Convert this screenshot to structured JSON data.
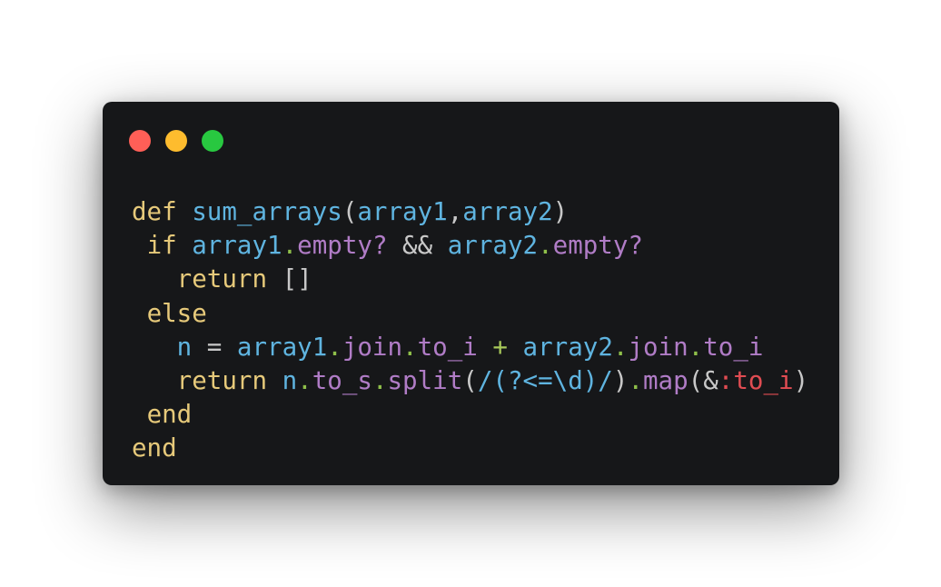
{
  "window": {
    "controls": [
      "close",
      "minimize",
      "zoom"
    ],
    "colors": {
      "background": "#161719",
      "close": "#ff5f57",
      "minimize": "#febc2e",
      "zoom": "#28c840"
    }
  },
  "code": {
    "language": "ruby",
    "lines": [
      [
        {
          "t": "def",
          "c": "kw"
        },
        {
          "t": " ",
          "c": "op"
        },
        {
          "t": "sum_arrays",
          "c": "fn"
        },
        {
          "t": "(",
          "c": "op"
        },
        {
          "t": "array1",
          "c": "var"
        },
        {
          "t": ",",
          "c": "op"
        },
        {
          "t": "array2",
          "c": "var"
        },
        {
          "t": ")",
          "c": "op"
        }
      ],
      [
        {
          "t": " ",
          "c": "op"
        },
        {
          "t": "if",
          "c": "kw"
        },
        {
          "t": " ",
          "c": "op"
        },
        {
          "t": "array1",
          "c": "var"
        },
        {
          "t": ".",
          "c": "dotp"
        },
        {
          "t": "empty?",
          "c": "meth"
        },
        {
          "t": " && ",
          "c": "op"
        },
        {
          "t": "array2",
          "c": "var"
        },
        {
          "t": ".",
          "c": "dotp"
        },
        {
          "t": "empty?",
          "c": "meth"
        }
      ],
      [
        {
          "t": "   ",
          "c": "op"
        },
        {
          "t": "return",
          "c": "kw"
        },
        {
          "t": " []",
          "c": "op"
        }
      ],
      [
        {
          "t": " ",
          "c": "op"
        },
        {
          "t": "else",
          "c": "kw"
        }
      ],
      [
        {
          "t": "   ",
          "c": "op"
        },
        {
          "t": "n",
          "c": "var"
        },
        {
          "t": " = ",
          "c": "op"
        },
        {
          "t": "array1",
          "c": "var"
        },
        {
          "t": ".",
          "c": "dotp"
        },
        {
          "t": "join",
          "c": "meth"
        },
        {
          "t": ".",
          "c": "dotp"
        },
        {
          "t": "to_i",
          "c": "meth"
        },
        {
          "t": " ",
          "c": "op"
        },
        {
          "t": "+",
          "c": "plus"
        },
        {
          "t": " ",
          "c": "op"
        },
        {
          "t": "array2",
          "c": "var"
        },
        {
          "t": ".",
          "c": "dotp"
        },
        {
          "t": "join",
          "c": "meth"
        },
        {
          "t": ".",
          "c": "dotp"
        },
        {
          "t": "to_i",
          "c": "meth"
        }
      ],
      [
        {
          "t": "   ",
          "c": "op"
        },
        {
          "t": "return",
          "c": "kw"
        },
        {
          "t": " ",
          "c": "op"
        },
        {
          "t": "n",
          "c": "var"
        },
        {
          "t": ".",
          "c": "dotp"
        },
        {
          "t": "to_s",
          "c": "meth"
        },
        {
          "t": ".",
          "c": "dotp"
        },
        {
          "t": "split",
          "c": "meth"
        },
        {
          "t": "(",
          "c": "op"
        },
        {
          "t": "/(?<=\\d)/",
          "c": "re"
        },
        {
          "t": ")",
          "c": "op"
        },
        {
          "t": ".",
          "c": "dotp"
        },
        {
          "t": "map",
          "c": "meth"
        },
        {
          "t": "(&",
          "c": "op"
        },
        {
          "t": ":to_i",
          "c": "sym"
        },
        {
          "t": ")",
          "c": "op"
        }
      ],
      [
        {
          "t": " ",
          "c": "op"
        },
        {
          "t": "end",
          "c": "kw"
        }
      ],
      [
        {
          "t": "end",
          "c": "kw"
        }
      ]
    ]
  }
}
